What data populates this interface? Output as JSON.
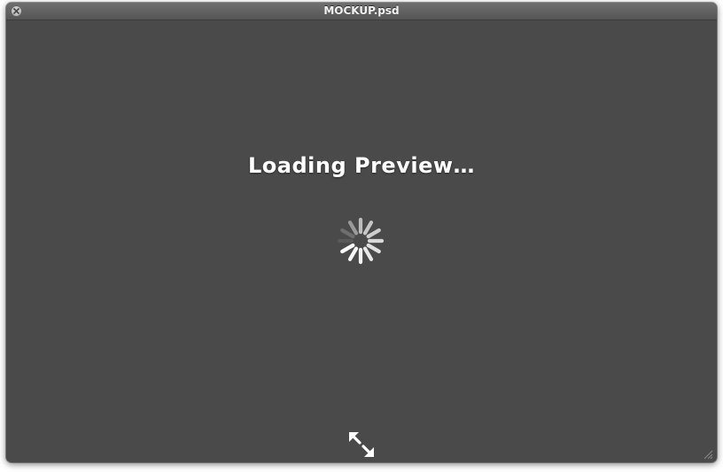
{
  "window": {
    "title": "MOCKUP.psd"
  },
  "main": {
    "status_text": "Loading Preview…"
  },
  "controls": {
    "close_icon": "close-icon",
    "fullscreen_icon": "fullscreen-expand-icon",
    "spinner_icon": "loading-spinner-icon",
    "resize_icon": "resize-grip-icon"
  },
  "colors": {
    "window_background": "#4a4a4a",
    "text": "#ffffff"
  }
}
